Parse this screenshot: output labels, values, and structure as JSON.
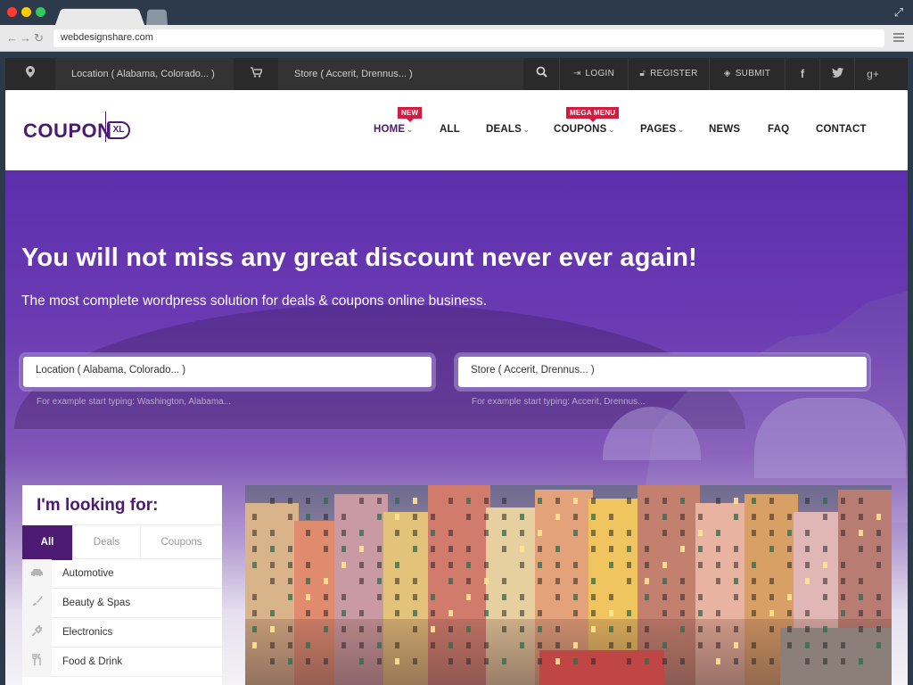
{
  "browser": {
    "url": "webdesignshare.com",
    "dot_colors": [
      "#ff3b30",
      "#ffcc00",
      "#34c759"
    ]
  },
  "topbar": {
    "location_placeholder": "Location ( Alabama, Colorado... )",
    "store_placeholder": "Store ( Accerit, Drennus... )",
    "login": "LOGIN",
    "register": "REGISTER",
    "submit": "SUBMIT",
    "icons": [
      "map-marker-icon",
      "cart-icon",
      "search-icon",
      "facebook-icon",
      "twitter-icon",
      "google-plus-icon"
    ]
  },
  "header": {
    "logo_text": "COUPON",
    "logo_suffix": "XL",
    "nav": [
      {
        "label": "HOME",
        "badge": "NEW"
      },
      {
        "label": "ALL"
      },
      {
        "label": "DEALS"
      },
      {
        "label": "COUPONS",
        "badge": "MEGA MENU"
      },
      {
        "label": "PAGES"
      },
      {
        "label": "NEWS"
      },
      {
        "label": "FAQ"
      },
      {
        "label": "CONTACT"
      }
    ]
  },
  "hero": {
    "title": "You will not miss any great discount never ever again!",
    "subtitle": "The most complete wordpress solution for deals & coupons online business.",
    "location_value": "Location ( Alabama, Colorado... )",
    "location_hint": "For example start typing: Washington, Alabama...",
    "store_value": "Store ( Accerit, Drennus... )",
    "store_hint": "For example start typing: Accerit, Drennus..."
  },
  "panel": {
    "title": "I'm looking for:",
    "tabs": [
      "All",
      "Deals",
      "Coupons"
    ],
    "categories": [
      "Automotive",
      "Beauty & Spas",
      "Electronics",
      "Food & Drink"
    ]
  },
  "colors": {
    "brand": "#4c1a73",
    "badge": "#d51a3f",
    "topbar": "#2a2a2a"
  }
}
